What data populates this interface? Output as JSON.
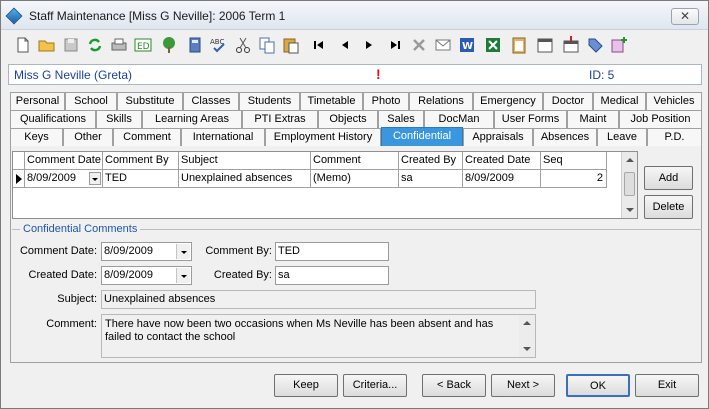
{
  "window": {
    "title": "Staff Maintenance  [Miss G Neville]:  2006 Term 1",
    "close_glyph": "✕"
  },
  "toolbar": {
    "icons": [
      "new-document-icon",
      "open-folder-icon",
      "save-icon",
      "refresh-icon",
      "print-icon",
      "edit-icon",
      "tree-icon",
      "calculator-icon",
      "spellcheck-icon",
      "cut-icon",
      "copy-icon",
      "paste-icon",
      "first-record-icon",
      "previous-record-icon",
      "next-record-icon",
      "last-record-icon",
      "delete-icon",
      "email-icon",
      "word-icon",
      "excel-icon",
      "clipboard-icon",
      "calendar-icon",
      "calendar-delete-icon",
      "tag-icon",
      "add-note-icon"
    ]
  },
  "staff": {
    "name": "Miss G Neville (Greta)",
    "alert": "!",
    "id": "ID: 5"
  },
  "tabs": {
    "row1": [
      "Personal",
      "School",
      "Substitute",
      "Classes",
      "Students",
      "Timetable",
      "Photo",
      "Relations",
      "Emergency",
      "Doctor",
      "Medical",
      "Vehicles"
    ],
    "row2": [
      "Qualifications",
      "Skills",
      "Learning Areas",
      "PTI Extras",
      "Objects",
      "Sales",
      "DocMan",
      "User Forms",
      "Maint",
      "Job Position"
    ],
    "row3": [
      "Keys",
      "Other",
      "Comment",
      "International",
      "Employment History",
      "Confidential",
      "Appraisals",
      "Absences",
      "Leave",
      "P.D."
    ],
    "active": "Confidential"
  },
  "grid": {
    "columns": [
      "Comment Date",
      "Comment By",
      "Subject",
      "Comment",
      "Created By",
      "Created Date",
      "Seq"
    ],
    "rows": [
      [
        "8/09/2009",
        "TED",
        "Unexplained absences",
        "(Memo)",
        "sa",
        "8/09/2009",
        "2"
      ]
    ]
  },
  "actions": {
    "add": "Add",
    "delete": "Delete"
  },
  "form": {
    "legend": "Confidential Comments",
    "comment_date_label": "Comment Date:",
    "comment_date": "8/09/2009",
    "comment_by_label": "Comment By:",
    "comment_by": "TED",
    "created_date_label": "Created Date:",
    "created_date": "8/09/2009",
    "created_by_label": "Created By:",
    "created_by": "sa",
    "subject_label": "Subject:",
    "subject": "Unexplained absences",
    "comment_label": "Comment:",
    "comment": "There have now been two occasions when Ms Neville has been absent and has failed to contact the school"
  },
  "footer": {
    "keep": "Keep",
    "criteria": "Criteria...",
    "back": "< Back",
    "next": "Next >",
    "ok": "OK",
    "exit": "Exit"
  }
}
